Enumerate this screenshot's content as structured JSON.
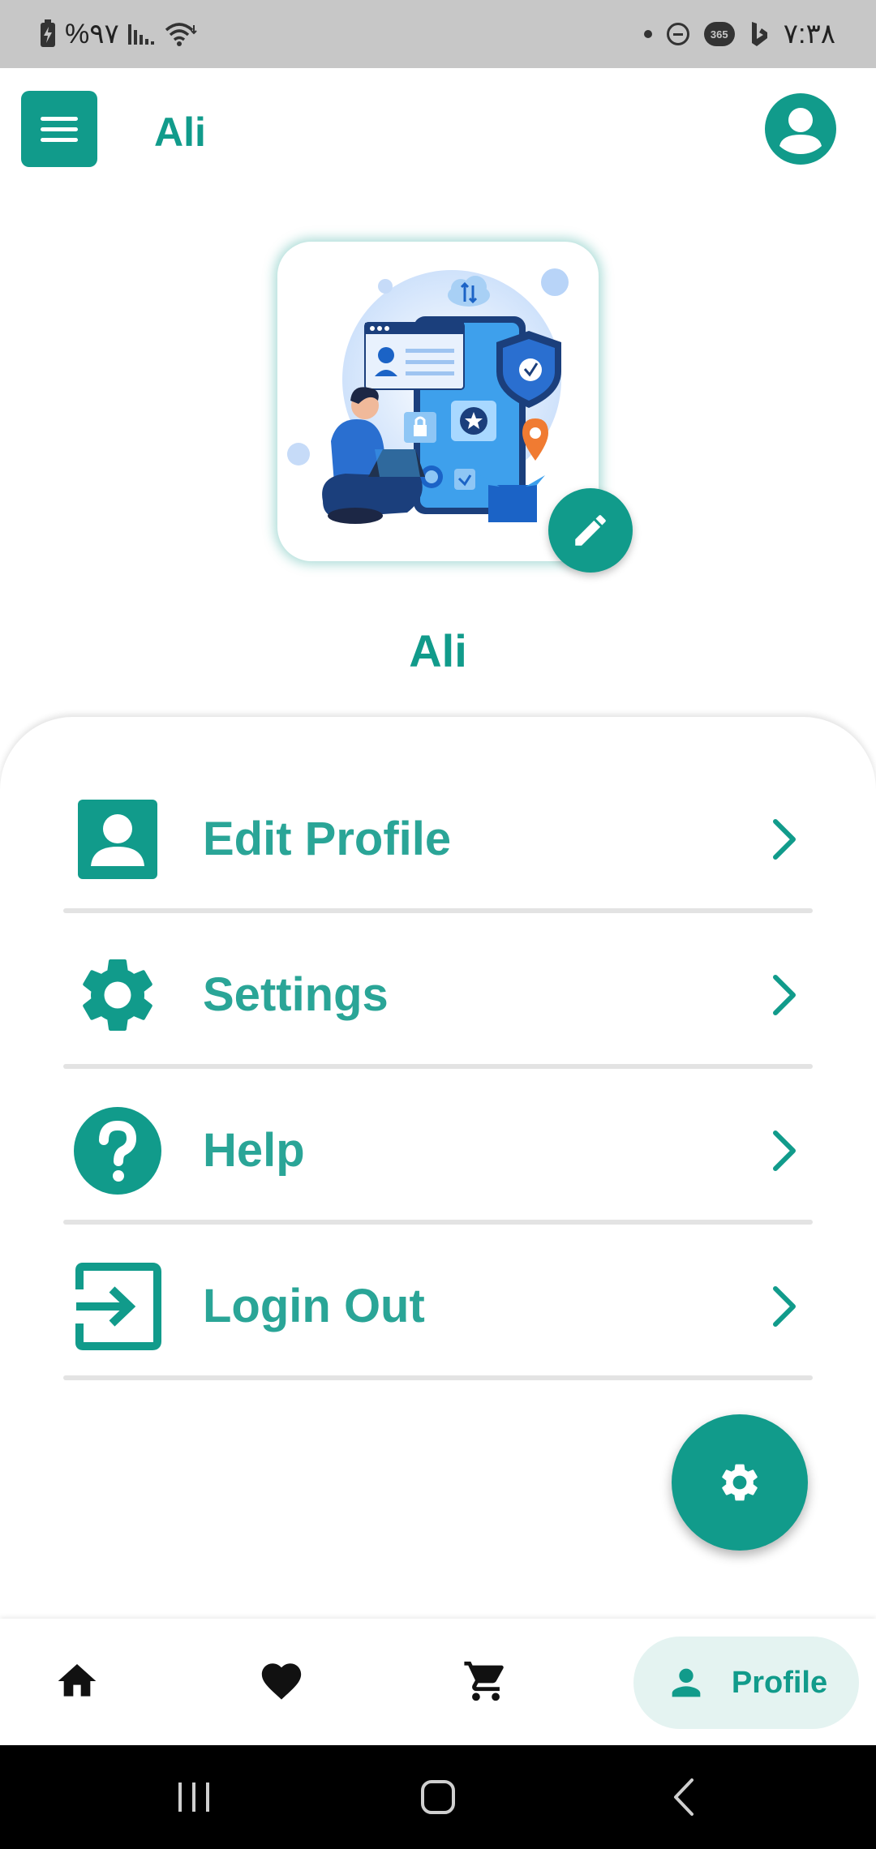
{
  "status_bar": {
    "battery": "%۹۷",
    "time": "۷:۳۸",
    "badge_365": "365",
    "icons": [
      "battery-charging-icon",
      "signal-icon",
      "wifi-icon",
      "dot-icon",
      "dnd-icon",
      "app-365-icon",
      "bing-icon"
    ]
  },
  "app_bar": {
    "title": "Ali",
    "menu_icon": "hamburger-menu-icon",
    "account_icon": "account-circle-icon"
  },
  "profile": {
    "name": "Ali",
    "avatar_image": "security-illustration",
    "edit_icon": "pencil-icon"
  },
  "menu": {
    "items": [
      {
        "label": "Edit Profile",
        "icon": "person-badge-icon"
      },
      {
        "label": "Settings",
        "icon": "gear-icon"
      },
      {
        "label": "Help",
        "icon": "help-circle-icon"
      },
      {
        "label": "Login Out",
        "icon": "logout-icon"
      }
    ]
  },
  "fab": {
    "icon": "gear-icon"
  },
  "bottom_nav": {
    "items": [
      {
        "icon": "home-icon"
      },
      {
        "icon": "heart-icon"
      },
      {
        "icon": "cart-icon"
      },
      {
        "icon": "person-icon",
        "label": "Profile",
        "selected": true
      }
    ]
  },
  "colors": {
    "primary": "#119b8b",
    "menu_text": "#2aa597",
    "status_bar": "#c7c7c7",
    "selected_nav_bg": "#e4f3f1"
  }
}
